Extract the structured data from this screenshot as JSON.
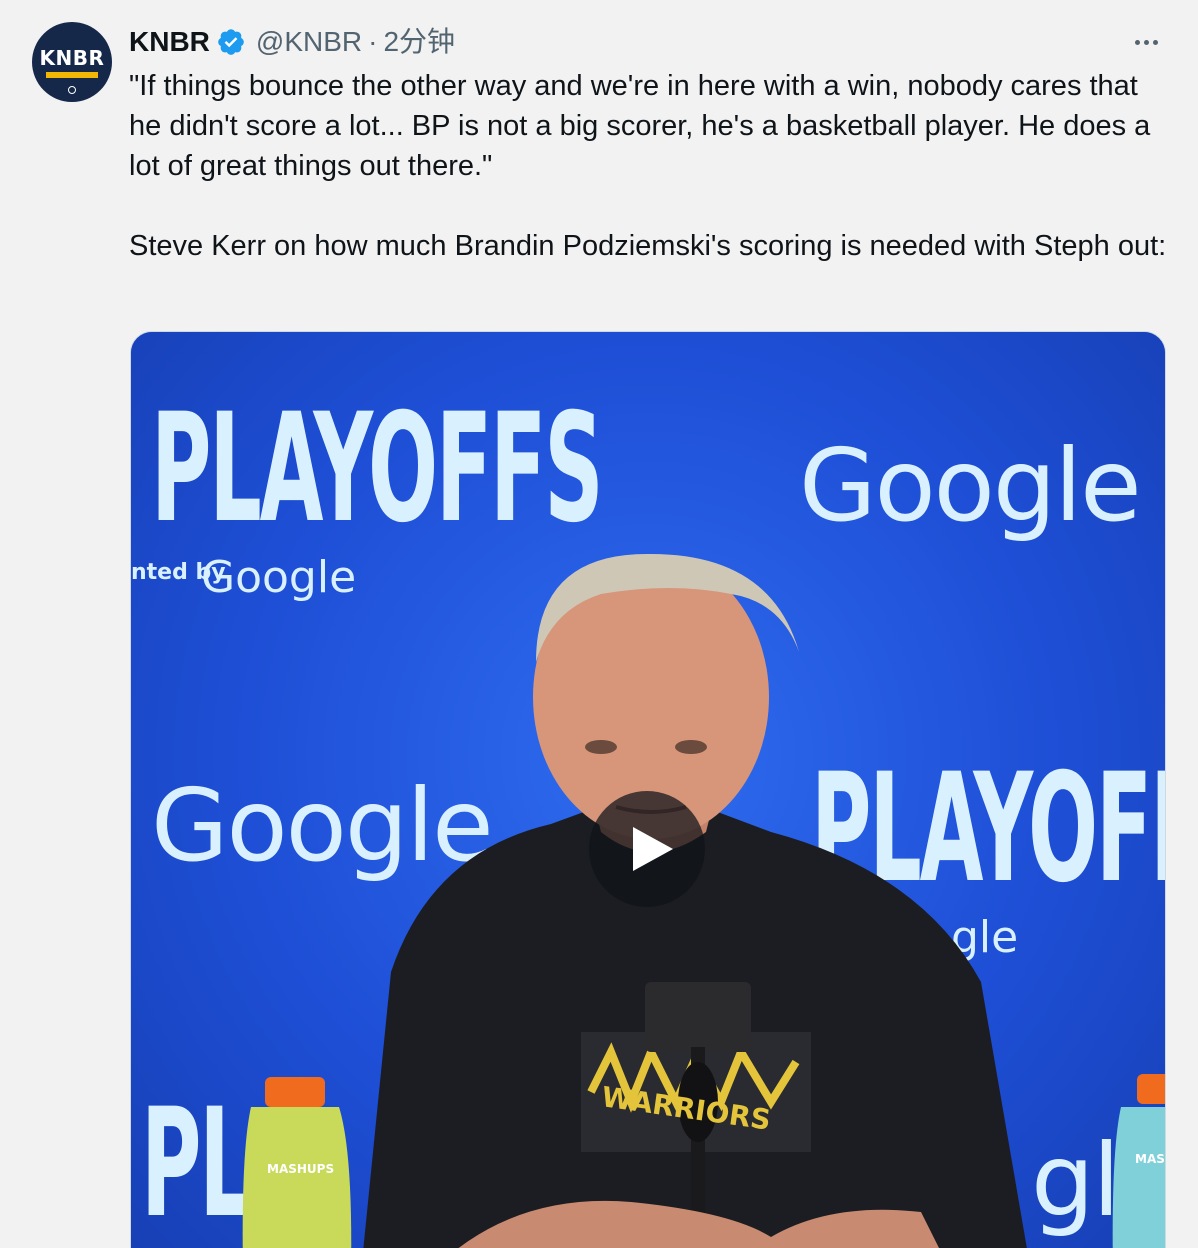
{
  "tweet": {
    "author_name": "KNBR",
    "handle": "@KNBR",
    "separator": "·",
    "time": "2分钟",
    "avatar_text": "KNBR",
    "verified_icon": "verified-badge-icon",
    "more_icon": "more-options-icon",
    "paragraphs": [
      "\"If things bounce the other way and we're in here with a win, nobody cares that he didn't score a lot... BP is not a big scorer, he's a basketball player. He does a lot of great things out there.\"",
      "Steve Kerr on how much Brandin Podziemski's scoring is needed with Steph out:"
    ]
  },
  "media": {
    "type": "video",
    "play_icon": "play-icon",
    "backdrop_text": {
      "playoffs": "PLAYOFFS",
      "google": "Google",
      "presented": "nted by",
      "partial_playoffs": "PLAYOFFS",
      "partial_google": "gle",
      "bottom_left": "PL",
      "bottom_right": "gle",
      "bottle_label_left": "MASHUPS",
      "bottle_label_right": "MAS",
      "shirt_text": "WARRIORS"
    }
  },
  "colors": {
    "verified_blue": "#1d9bf0",
    "secondary_text": "#536471",
    "backdrop_blue": "#1f52d8"
  }
}
